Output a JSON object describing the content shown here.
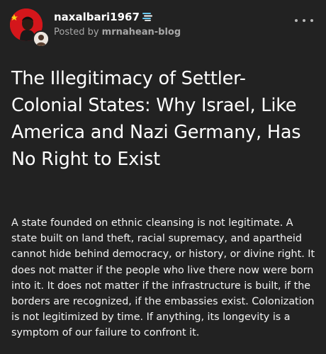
{
  "post": {
    "username": "naxalbari1967",
    "posted_by_prefix": "Posted by",
    "posted_by_blog": "mrnahean-blog",
    "title": "The Illegitimacy of Settler-Colonial States: Why Israel, Like America and Nazi Germany, Has No Right to Exist",
    "body": "A state founded on ethnic cleansing is not legitimate. A state built on land theft, racial supremacy, and apartheid cannot hide behind democracy, or history, or divine right. It does not matter if the people who live there now were born into it. It does not matter if the infrastructure is built, if the borders are recognized, if the embassies exist. Colonization is not legitimized by time. If anything, its longevity is a symptom of our failure to confront it."
  },
  "icons": {
    "avatar": "profile-avatar",
    "sub_avatar": "reblogger-avatar",
    "badge": "blog-badge-icon",
    "more": "more-options-icon"
  },
  "colors": {
    "background": "#222222",
    "text": "#ffffff",
    "muted": "#a8a8a8",
    "avatar_red": "#d4161b"
  }
}
